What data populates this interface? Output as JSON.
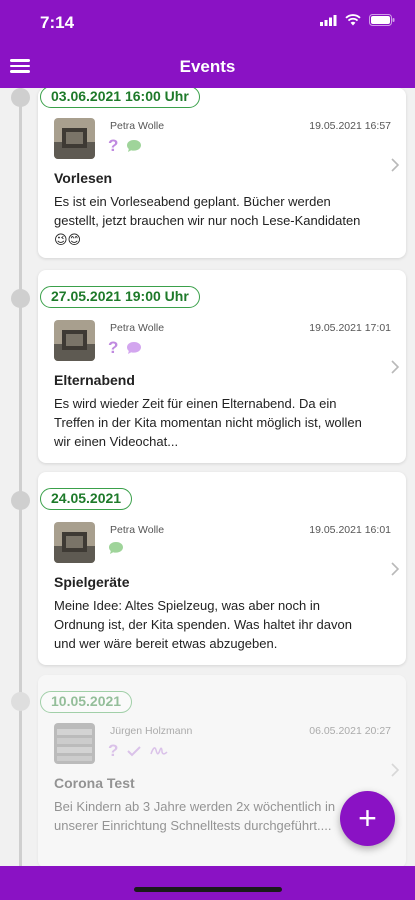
{
  "status_bar": {
    "time": "7:14"
  },
  "header": {
    "title": "Events"
  },
  "events": [
    {
      "date": "03.06.2021 16:00 Uhr",
      "author": "Petra Wolle",
      "timestamp": "19.05.2021 16:57",
      "title": "Vorlesen",
      "text": "Es ist ein Vorleseabend geplant. Bücher werden gestellt, jetzt brauchen wir nur noch Lese-Kandidaten 😉😊"
    },
    {
      "date": "27.05.2021 19:00 Uhr",
      "author": "Petra Wolle",
      "timestamp": "19.05.2021 17:01",
      "title": "Elternabend",
      "text": "Es wird wieder Zeit für einen Elternabend. Da ein Treffen in der Kita momentan nicht möglich ist, wollen wir einen Videochat..."
    },
    {
      "date": "24.05.2021",
      "author": "Petra Wolle",
      "timestamp": "19.05.2021 16:01",
      "title": "Spielgeräte",
      "text": "Meine Idee: Altes Spielzeug, was aber noch in Ordnung ist, der Kita spenden. Was haltet ihr davon und wer wäre bereit etwas abzugeben."
    },
    {
      "date": "10.05.2021",
      "author": "Jürgen Holzmann",
      "timestamp": "06.05.2021 20:27",
      "title": "Corona Test",
      "text": "Bei Kindern ab 3 Jahre werden 2x wöchentlich in unserer Einrichtung Schnelltests durchgeführt...."
    }
  ],
  "fab": {
    "label": "+"
  },
  "colors": {
    "brand": "#8a12c4",
    "badge_green": "#3aa04a",
    "question": "#c08ae0",
    "chat_green": "#9fd49a",
    "chat_purple": "#d3a6ef"
  }
}
